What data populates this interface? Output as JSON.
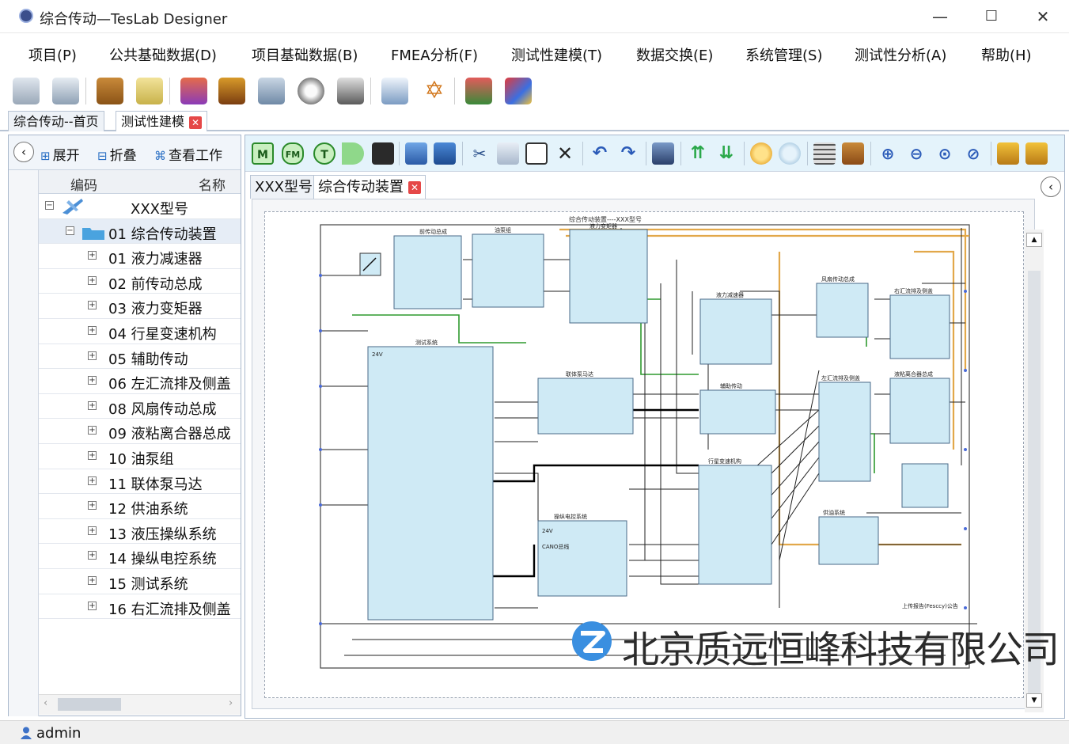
{
  "window": {
    "title": "综合传动—TesLab Designer",
    "minimize": "—",
    "maximize": "☐",
    "close": "✕"
  },
  "menu": [
    "项目(P)",
    "公共基础数据(D)",
    "项目基础数据(B)",
    "FMEA分析(F)",
    "测试性建模(T)",
    "数据交换(E)",
    "系统管理(S)",
    "测试性分析(A)",
    "帮助(H)"
  ],
  "toolbar_icons": [
    "database-add-icon",
    "database-edit-icon",
    "package-icon",
    "tag-icon",
    "gift-icon",
    "tools-icon",
    "network-icon",
    "settings-icon",
    "cleaner-icon",
    "monitor-icon",
    "star-icon",
    "flask-icon",
    "chart-icon"
  ],
  "doc_tabs": [
    {
      "label": "综合传动--首页"
    },
    {
      "label": "测试性建模"
    }
  ],
  "left_panel": {
    "collapse": "‹",
    "buttons": {
      "expand": "展开",
      "fold": "折叠",
      "view": "查看工作"
    },
    "columns": {
      "code": "编码",
      "name": "名称"
    },
    "tree": [
      {
        "label": "XXX型号"
      },
      {
        "label": "01 综合传动装置"
      },
      {
        "label": "01 液力减速器"
      },
      {
        "label": "02 前传动总成"
      },
      {
        "label": "03 液力变矩器"
      },
      {
        "label": "04 行星变速机构"
      },
      {
        "label": "05 辅助传动"
      },
      {
        "label": "06 左汇流排及侧盖"
      },
      {
        "label": "08 风扇传动总成"
      },
      {
        "label": "09 液粘离合器总成"
      },
      {
        "label": "10 油泵组"
      },
      {
        "label": "11 联体泵马达"
      },
      {
        "label": "12 供油系统"
      },
      {
        "label": "13 液压操纵系统"
      },
      {
        "label": "14 操纵电控系统"
      },
      {
        "label": "15 测试系统"
      },
      {
        "label": "16 右汇流排及侧盖"
      }
    ]
  },
  "right_panel": {
    "toolbar": {
      "module": "M",
      "fm": "FM",
      "test": "T"
    },
    "sub_tabs": [
      {
        "label": "XXX型号"
      },
      {
        "label": "综合传动装置"
      }
    ],
    "collapse": "‹",
    "scroll_up": "▲",
    "scroll_down": "▼"
  },
  "diagram": {
    "title": "综合传动装置----XXX型号",
    "blocks": {
      "b1": "前传动总成",
      "b2": "油泵组",
      "b3": "液力变矩器",
      "b4": "测试系统",
      "b5": "联体泵马达",
      "b6": "液力减速器",
      "b7": "辅助传动",
      "b8": "行星变速机构",
      "b9": "左汇流排及侧盖",
      "b10": "右汇流排及侧盖",
      "b11": "风扇传动总成",
      "b12": "液粘离合器总成",
      "b13": "操纵电控系统",
      "b14": "供油系统"
    },
    "labels": {
      "v24": "24V",
      "can": "CANO总线",
      "upload": "上传报告(Fesccy)公告"
    }
  },
  "watermark": {
    "text": "北京质远恒峰科技有限公司"
  },
  "status": {
    "user": "admin"
  }
}
